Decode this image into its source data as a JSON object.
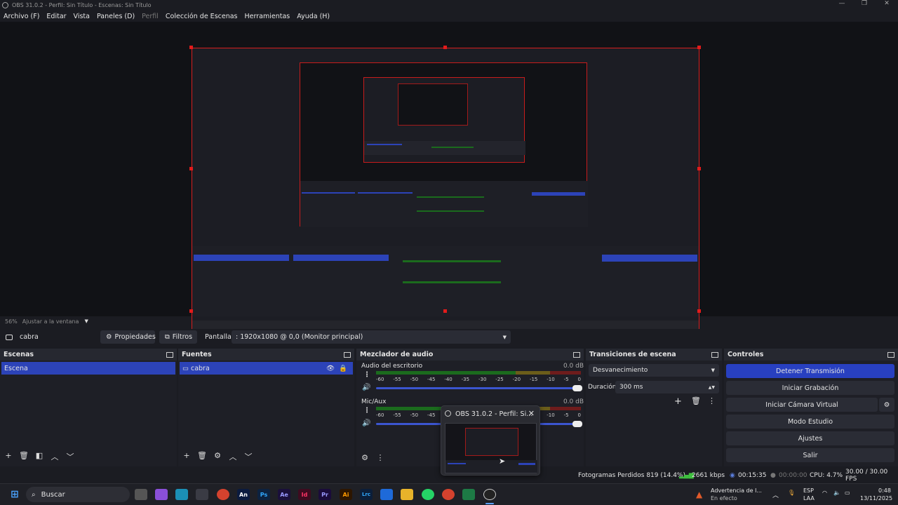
{
  "window": {
    "title": "OBS 31.0.2 - Perfil: Sin Título - Escenas: Sin Título",
    "controls": [
      "—",
      "❐",
      "✕"
    ]
  },
  "menu": [
    "Archivo (F)",
    "Editar",
    "Vista",
    "Paneles (D)",
    "Perfil",
    "Colección de Escenas",
    "Herramientas",
    "Ayuda (H)"
  ],
  "preview": {
    "zoom": "56%",
    "fit_label": "Ajustar a la ventana"
  },
  "source_bar": {
    "source_name": "cabra",
    "properties_label": "Propiedades",
    "filters_label": "Filtros",
    "display_label": "Pantalla",
    "display_value": ": 1920x1080 @ 0,0 (Monitor principal)"
  },
  "scenes": {
    "title": "Escenas",
    "items": [
      "Escena"
    ]
  },
  "sources": {
    "title": "Fuentes",
    "items": [
      "cabra"
    ]
  },
  "mixer": {
    "title": "Mezclador de audio",
    "ticks": [
      "-60",
      "-55",
      "-50",
      "-45",
      "-40",
      "-35",
      "-30",
      "-25",
      "-20",
      "-15",
      "-10",
      "-5",
      "0"
    ],
    "channels": [
      {
        "name": "Audio del escritorio",
        "db": "0.0 dB"
      },
      {
        "name": "Mic/Aux",
        "db": "0.0 dB"
      }
    ]
  },
  "transitions": {
    "title": "Transiciones de escena",
    "selected": "Desvanecimiento",
    "duration_label": "Duración",
    "duration_value": "300 ms"
  },
  "controls": {
    "title": "Controles",
    "buttons": [
      "Detener Transmisión",
      "Iniciar Grabación",
      "Iniciar Cámara Virtual",
      "Modo Estudio",
      "Ajustes",
      "Salir"
    ]
  },
  "status": {
    "dropped_frames": "Fotogramas Perdidos 819 (14.4%)",
    "bitrate": "2661 kbps",
    "stream_time": "00:15:35",
    "rec_time": "00:00:00",
    "cpu": "CPU: 4.7%",
    "fps": "30.00 / 30.00 FPS"
  },
  "popup": {
    "title": "OBS 31.0.2 - Perfil: Si...",
    "close": "✕"
  },
  "taskbar": {
    "search_placeholder": "Buscar",
    "notification_title": "Advertencia de l...",
    "notification_sub": "En efecto",
    "language": "ESP",
    "layout": "LAA",
    "time": "0:48",
    "date": "13/11/2025",
    "apps": [
      "An",
      "Ps",
      "Ae",
      "Id",
      "Pr",
      "Ai",
      "Lrc"
    ]
  },
  "colors": {
    "accent": "#2c43b8",
    "selection_red": "#d81e1e",
    "meter_green": "#1b6b1d",
    "meter_yellow": "#6b5d1a",
    "meter_red": "#6e1c1c"
  }
}
